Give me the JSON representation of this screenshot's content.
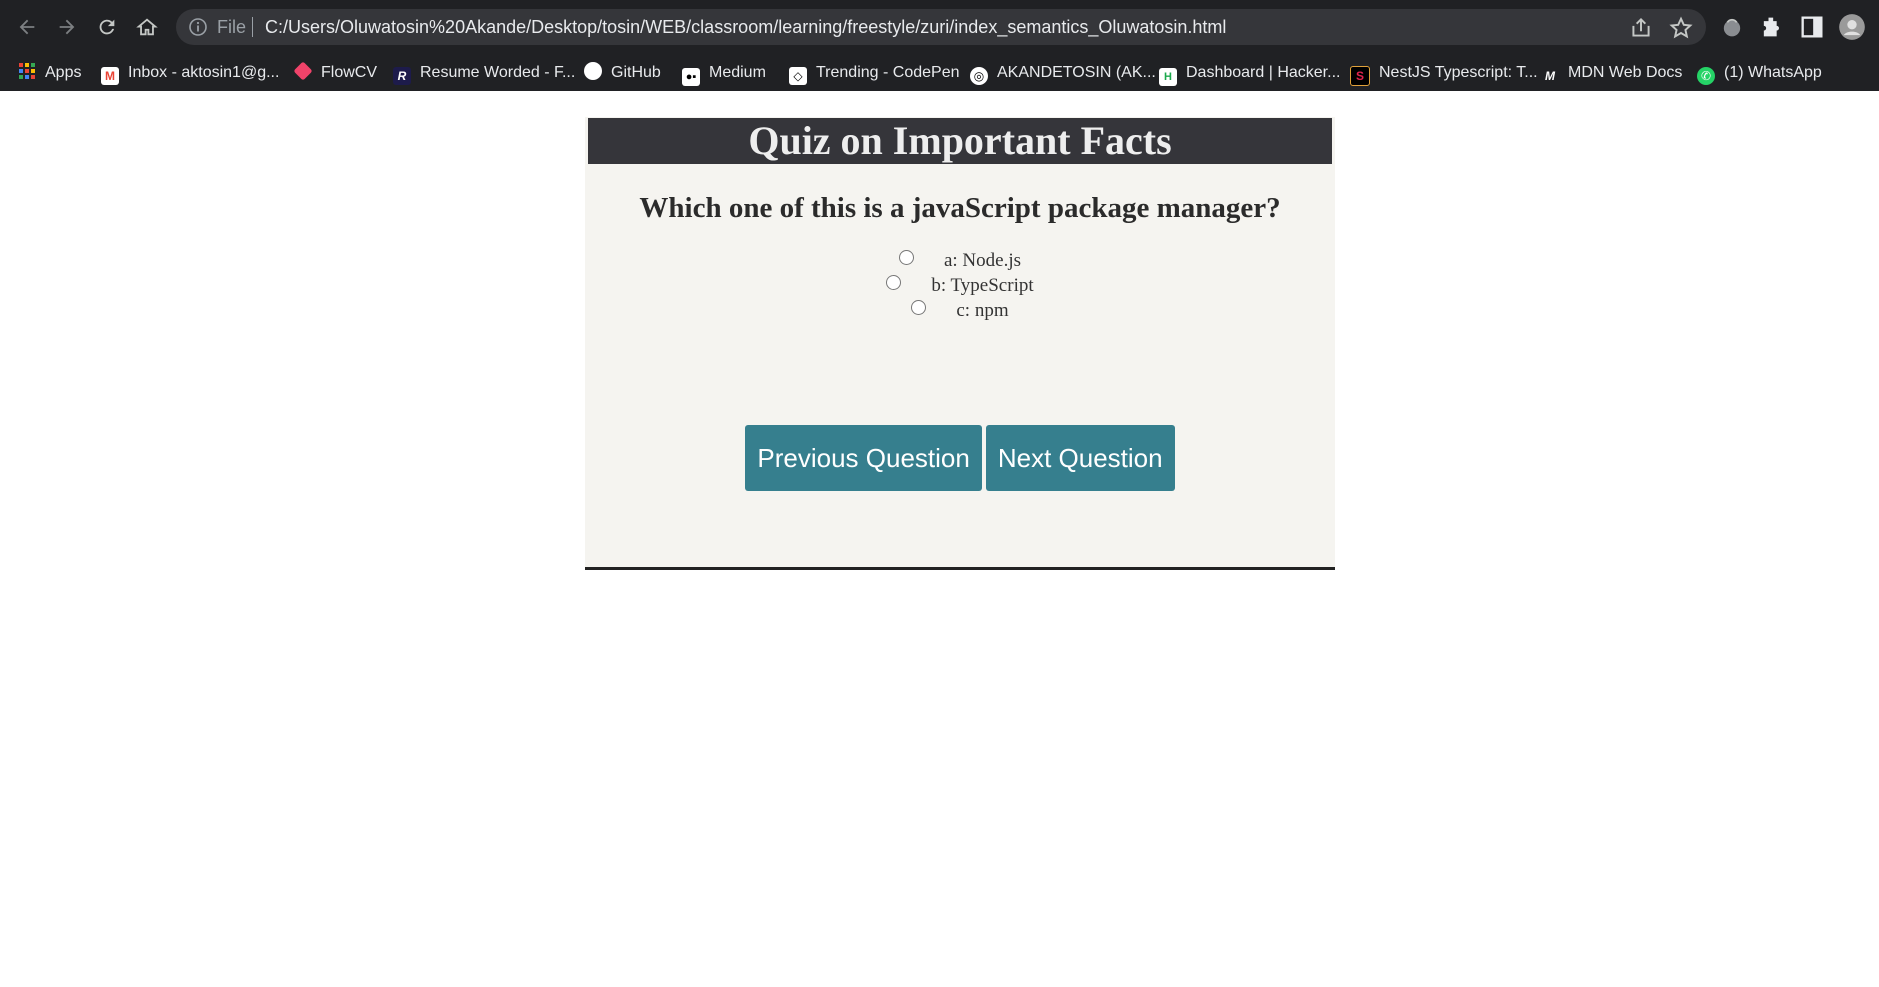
{
  "browser": {
    "address_scheme": "File",
    "address_url": "C:/Users/Oluwatosin%20Akande/Desktop/tosin/WEB/classroom/learning/freestyle/zuri/index_semantics_Oluwatosin.html"
  },
  "bookmarks": [
    {
      "label": "Apps",
      "icon": "apps-grid-icon"
    },
    {
      "label": "Inbox - aktosin1@g...",
      "icon": "gmail-icon"
    },
    {
      "label": "FlowCV",
      "icon": "flowcv-icon"
    },
    {
      "label": "Resume Worded - F...",
      "icon": "resume-worded-icon"
    },
    {
      "label": "GitHub",
      "icon": "github-icon"
    },
    {
      "label": "Medium",
      "icon": "medium-icon"
    },
    {
      "label": "Trending - CodePen",
      "icon": "codepen-icon"
    },
    {
      "label": "AKANDETOSIN (AK...",
      "icon": "circle-logo-icon"
    },
    {
      "label": "Dashboard | Hacker...",
      "icon": "hackerrank-icon"
    },
    {
      "label": "NestJS Typescript: T...",
      "icon": "nestjs-icon"
    },
    {
      "label": "MDN Web Docs",
      "icon": "mdn-icon"
    },
    {
      "label": "(1) WhatsApp",
      "icon": "whatsapp-icon"
    }
  ],
  "quiz": {
    "title": "Quiz on Important Facts",
    "question": "Which one of this is a javaScript package manager?",
    "answers": [
      {
        "label": "a: Node.js",
        "checked": false
      },
      {
        "label": "b: TypeScript",
        "checked": false
      },
      {
        "label": "c: npm",
        "checked": false
      }
    ],
    "prev_label": "Previous Question",
    "next_label": "Next Question"
  },
  "colors": {
    "chrome_bg": "#202124",
    "header_bg": "#35353a",
    "card_bg": "#f5f4f0",
    "button_bg": "#367f8e"
  }
}
